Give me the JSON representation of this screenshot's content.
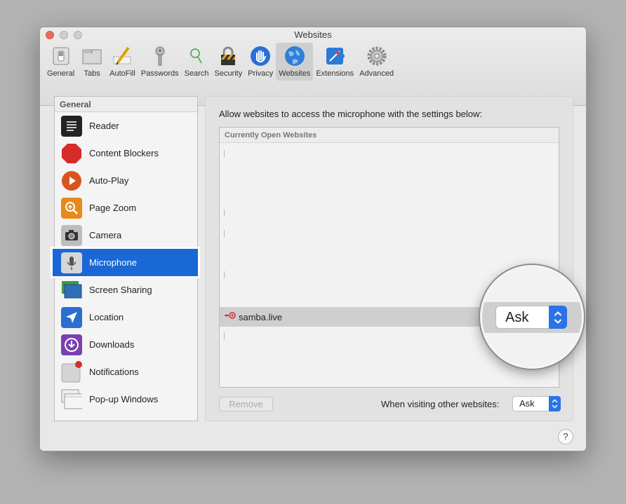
{
  "window": {
    "title": "Websites"
  },
  "toolbar": [
    {
      "label": "General",
      "icon": "switch-icon"
    },
    {
      "label": "Tabs",
      "icon": "tabs-icon"
    },
    {
      "label": "AutoFill",
      "icon": "pencil-form-icon"
    },
    {
      "label": "Passwords",
      "icon": "key-icon"
    },
    {
      "label": "Search",
      "icon": "magnifier-icon"
    },
    {
      "label": "Security",
      "icon": "padlock-icon"
    },
    {
      "label": "Privacy",
      "icon": "hand-icon"
    },
    {
      "label": "Websites",
      "icon": "globe-icon",
      "active": true
    },
    {
      "label": "Extensions",
      "icon": "puzzle-icon"
    },
    {
      "label": "Advanced",
      "icon": "gear-icon"
    }
  ],
  "sidebar": {
    "header": "General",
    "items": [
      {
        "label": "Reader",
        "icon": "reader-icon"
      },
      {
        "label": "Content Blockers",
        "icon": "stop-sign-icon"
      },
      {
        "label": "Auto-Play",
        "icon": "play-icon"
      },
      {
        "label": "Page Zoom",
        "icon": "zoom-icon"
      },
      {
        "label": "Camera",
        "icon": "camera-icon"
      },
      {
        "label": "Microphone",
        "icon": "microphone-icon",
        "selected": true
      },
      {
        "label": "Screen Sharing",
        "icon": "screen-sharing-icon"
      },
      {
        "label": "Location",
        "icon": "location-arrow-icon"
      },
      {
        "label": "Downloads",
        "icon": "download-icon"
      },
      {
        "label": "Notifications",
        "icon": "notification-icon"
      },
      {
        "label": "Pop-up Windows",
        "icon": "popup-windows-icon"
      }
    ]
  },
  "panel": {
    "description": "Allow websites to access the microphone with the settings below:",
    "list_header": "Currently Open Websites",
    "rows": [
      {
        "site": "samba.live",
        "setting": "Ask"
      }
    ],
    "remove_label": "Remove",
    "other_label": "When visiting other websites:",
    "other_value": "Ask"
  },
  "help_label": "?",
  "magnifier": {
    "value": "Ask"
  },
  "colors": {
    "accent": "#1a67d6",
    "select_arrow": "#2a73e6"
  }
}
